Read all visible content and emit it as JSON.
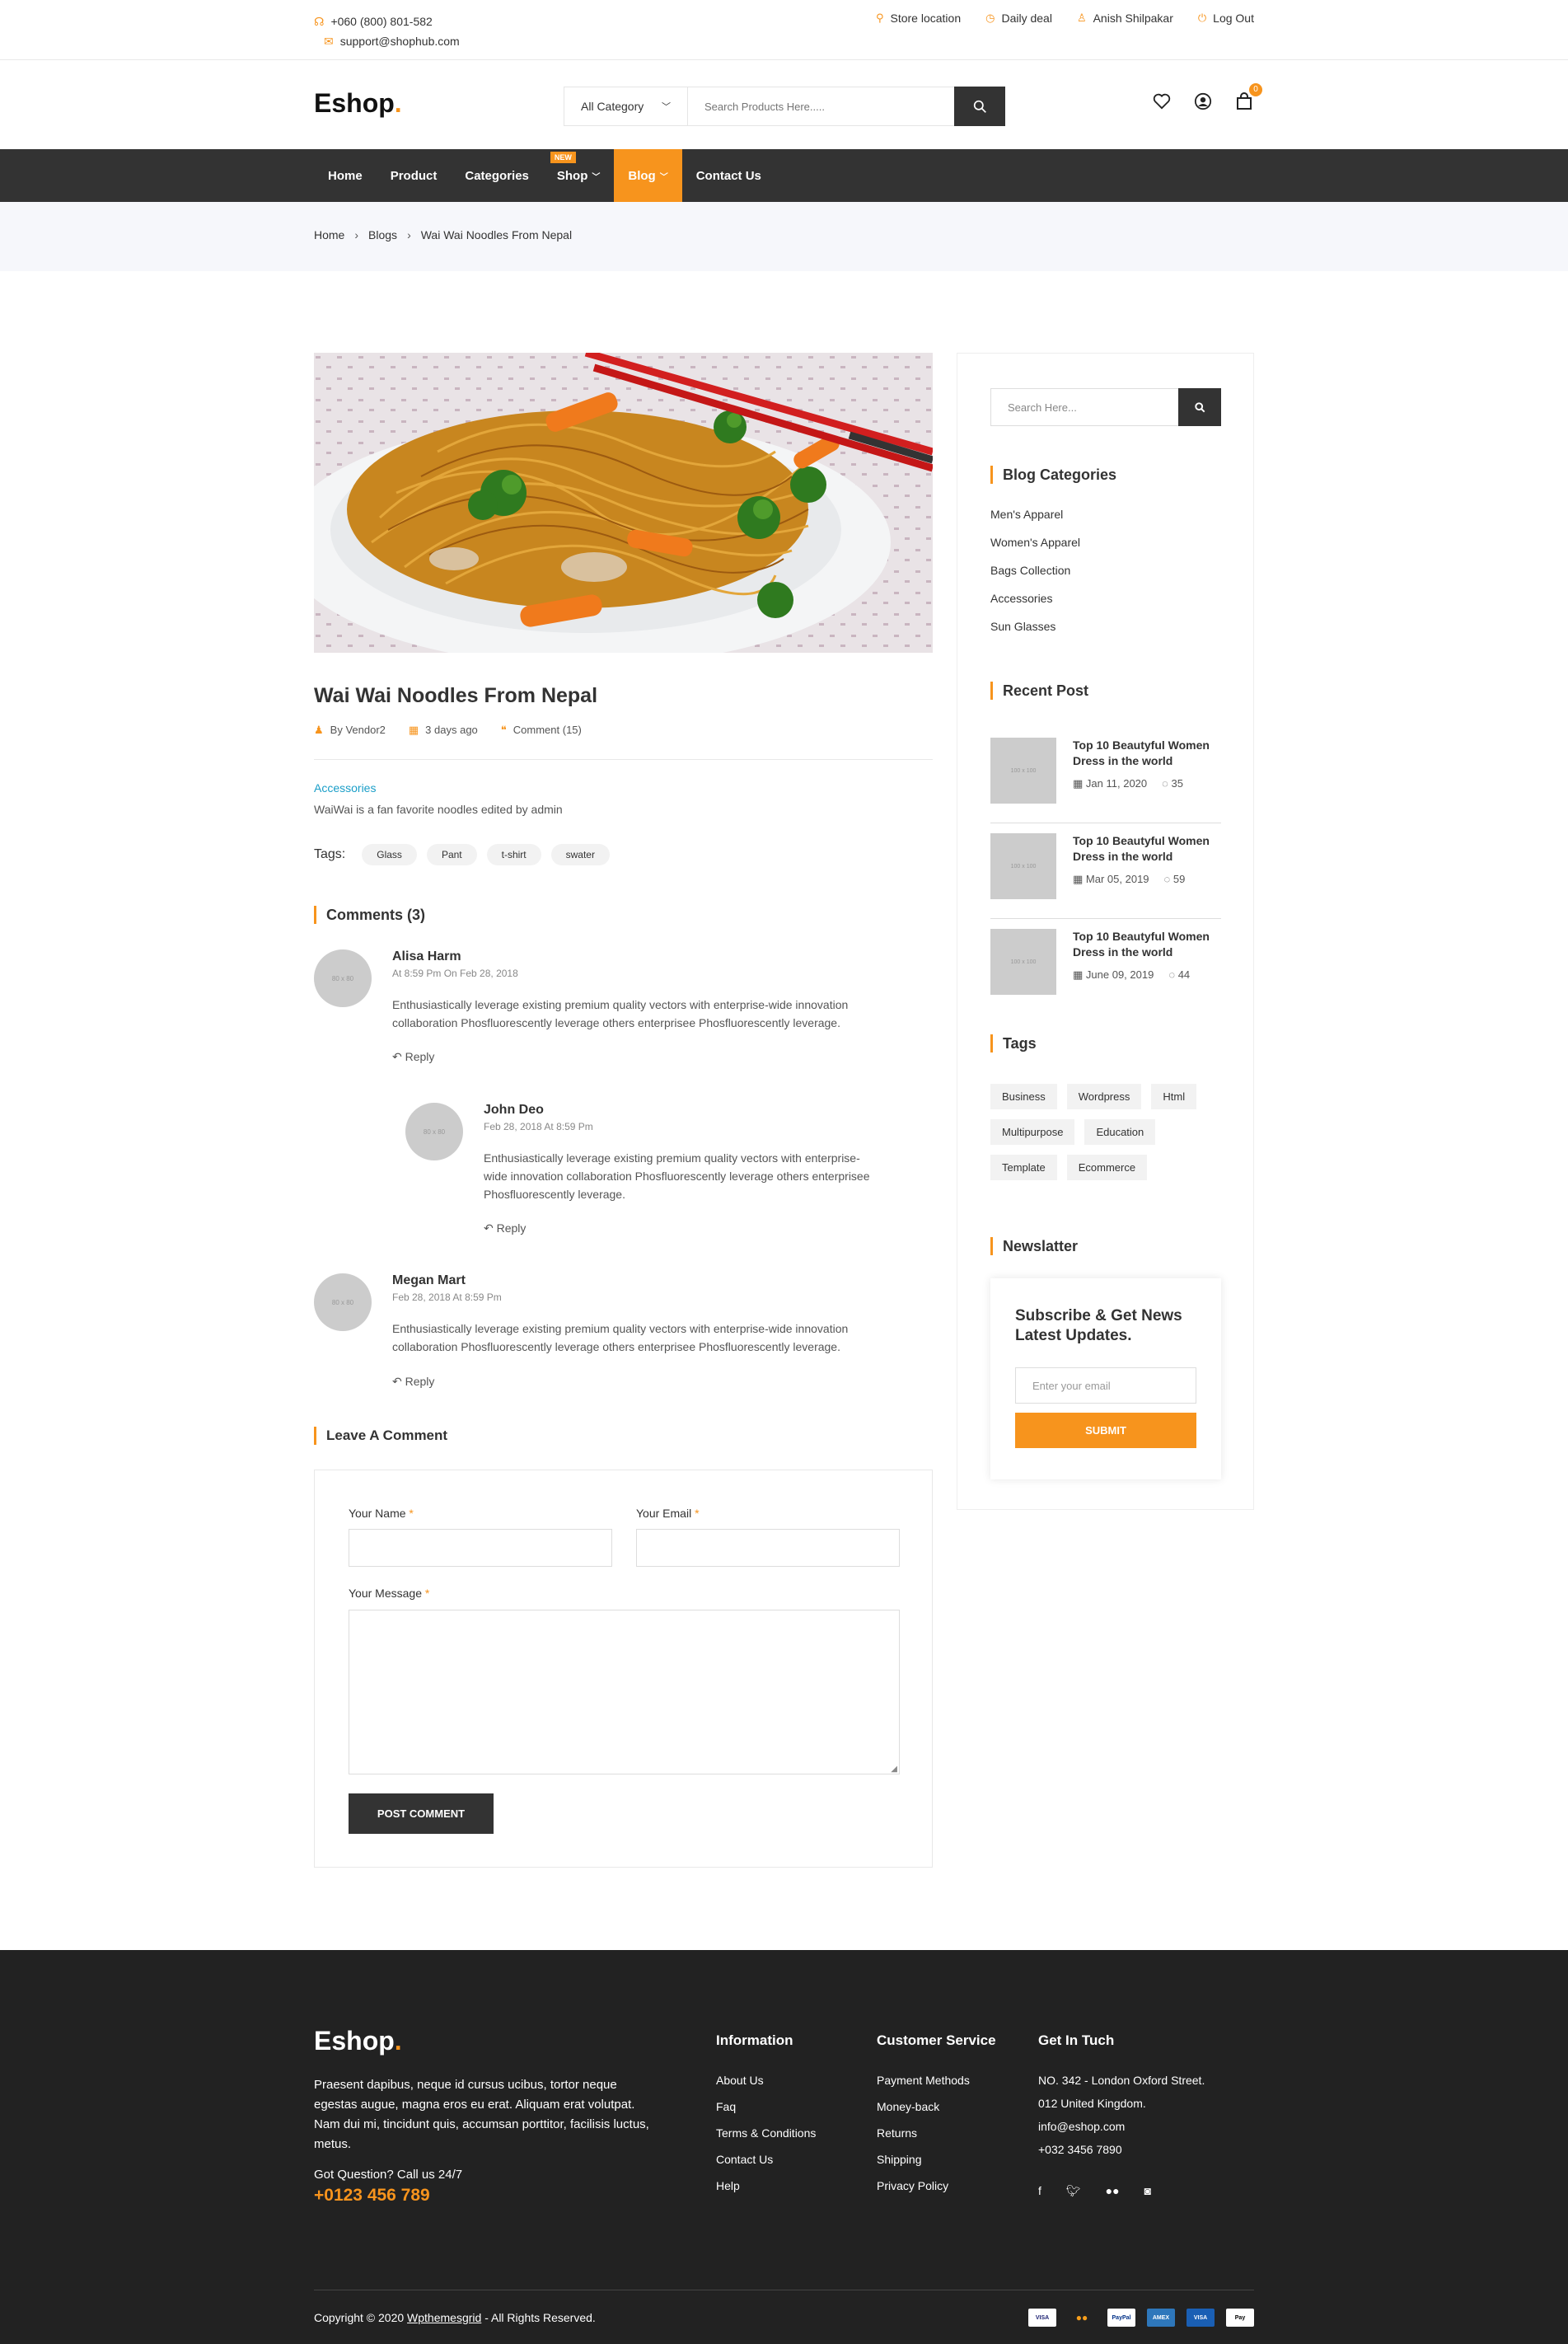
{
  "topbar": {
    "phone": "+060 (800) 801-582",
    "email": "support@shophub.com",
    "store_location": "Store location",
    "daily_deal": "Daily deal",
    "user": "Anish Shilpakar",
    "logout": "Log Out"
  },
  "header": {
    "logo": "Eshop",
    "category": "All Category",
    "search_placeholder": "Search Products Here.....",
    "cart_count": "0"
  },
  "nav": {
    "items": [
      "Home",
      "Product",
      "Categories",
      "Shop",
      "Blog",
      "Contact Us"
    ],
    "new_badge": "NEW",
    "active": "Blog"
  },
  "breadcrumb": [
    "Home",
    "Blogs",
    "Wai Wai Noodles From Nepal"
  ],
  "post": {
    "title": "Wai Wai Noodles From Nepal",
    "author": "By Vendor2",
    "date": "3 days ago",
    "comments": "Comment (15)",
    "category": "Accessories",
    "excerpt": "WaiWai is a fan favorite noodles edited by admin",
    "tags_label": "Tags:",
    "tags": [
      "Glass",
      "Pant",
      "t-shirt",
      "swater"
    ]
  },
  "comments": {
    "title": "Comments (3)",
    "avatar_placeholder": "80 x 80",
    "reply": "Reply",
    "items": [
      {
        "name": "Alisa Harm",
        "date": "At 8:59 Pm On Feb 28, 2018",
        "text1": "Enthusiastically leverage existing premium quality vectors with enterprise-wide innovation",
        "text2": "collaboration Phosfluorescently leverage others enterprisee Phosfluorescently leverage."
      },
      {
        "name": "John Deo",
        "date": "Feb 28, 2018 At 8:59 Pm",
        "text1": "Enthusiastically leverage existing premium quality vectors with enterprise-",
        "text2": "wide innovation collaboration Phosfluorescently leverage others enterprisee",
        "text3": "Phosfluorescently leverage."
      },
      {
        "name": "Megan Mart",
        "date": "Feb 28, 2018 At 8:59 Pm",
        "text1": "Enthusiastically leverage existing premium quality vectors with enterprise-wide innovation",
        "text2": "collaboration Phosfluorescently leverage others enterprisee Phosfluorescently leverage."
      }
    ]
  },
  "form": {
    "title": "Leave A Comment",
    "name_label": "Your Name",
    "email_label": "Your Email",
    "message_label": "Your Message",
    "required": "*",
    "submit": "POST COMMENT"
  },
  "sidebar": {
    "search_placeholder": "Search Here...",
    "categories_title": "Blog Categories",
    "categories": [
      "Men's Apparel",
      "Women's Apparel",
      "Bags Collection",
      "Accessories",
      "Sun Glasses"
    ],
    "recent_title": "Recent Post",
    "recent_img": "100 x 100",
    "recent": [
      {
        "title": "Top 10 Beautyful Women Dress in the world",
        "date": "Jan 11, 2020",
        "comments": "35"
      },
      {
        "title": "Top 10 Beautyful Women Dress in the world",
        "date": "Mar 05, 2019",
        "comments": "59"
      },
      {
        "title": "Top 10 Beautyful Women Dress in the world",
        "date": "June 09, 2019",
        "comments": "44"
      }
    ],
    "tags_title": "Tags",
    "tags": [
      "Business",
      "Wordpress",
      "Html",
      "Multipurpose",
      "Education",
      "Template",
      "Ecommerce"
    ],
    "newsletter_title": "Newslatter",
    "newsletter_heading": "Subscribe & Get News Latest Updates.",
    "newsletter_placeholder": "Enter your email",
    "newsletter_button": "SUBMIT"
  },
  "footer": {
    "logo": "Eshop",
    "about": "Praesent dapibus, neque id cursus ucibus, tortor neque egestas augue, magna eros eu erat. Aliquam erat volutpat. Nam dui mi, tincidunt quis, accumsan porttitor, facilisis luctus, metus.",
    "question": "Got Question? Call us 24/7",
    "phone": "+0123 456 789",
    "info_title": "Information",
    "info_links": [
      "About Us",
      "Faq",
      "Terms & Conditions",
      "Contact Us",
      "Help"
    ],
    "service_title": "Customer Service",
    "service_links": [
      "Payment Methods",
      "Money-back",
      "Returns",
      "Shipping",
      "Privacy Policy"
    ],
    "contact_title": "Get In Tuch",
    "contact": [
      "NO. 342 - London Oxford Street.",
      "012 United Kingdom.",
      "info@eshop.com",
      "+032 3456 7890"
    ],
    "copyright_pre": "Copyright © 2020",
    "copyright_link": "Wpthemesgrid",
    "copyright_post": "- All Rights Reserved.",
    "payments": [
      "VISA",
      "MC",
      "PayPal",
      "AMEX",
      "VISA",
      "Pay"
    ]
  },
  "colors": {
    "accent": "#F7941D",
    "dark": "#333333",
    "footer": "#222222",
    "link": "#1a9ec8"
  }
}
